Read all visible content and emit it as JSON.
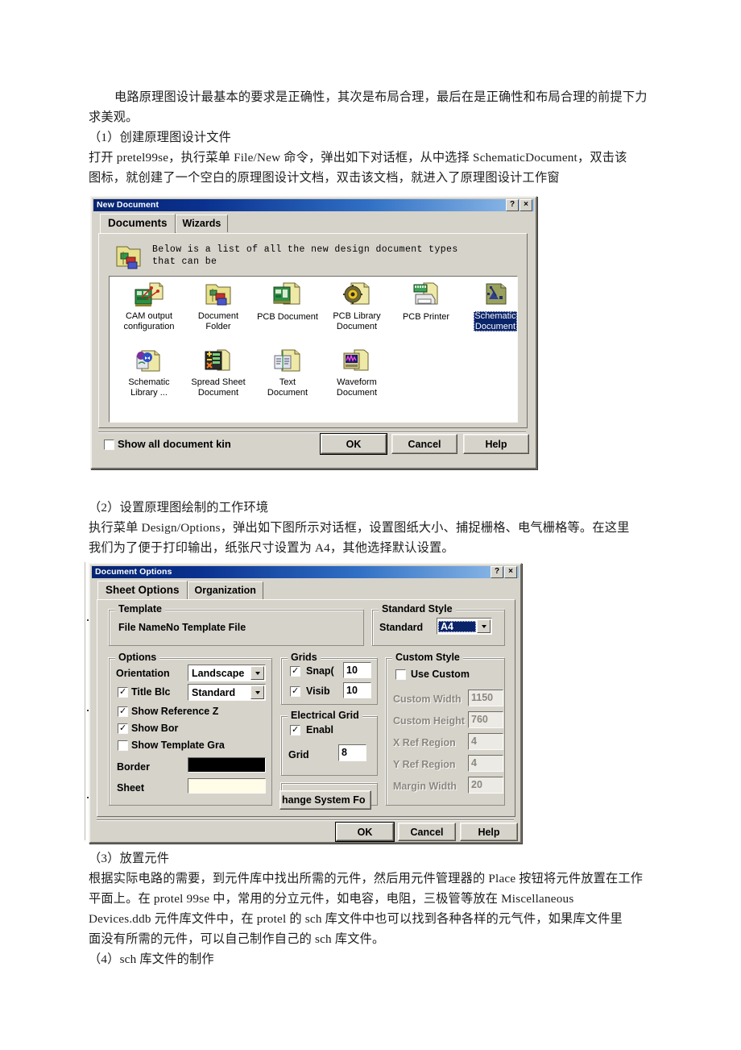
{
  "document": {
    "paragraphs": [
      "        电路原理图设计最基本的要求是正确性，其次是布局合理，最后在是正确性和布局合理的前提下力",
      "求美观。",
      "（1）创建原理图设计文件",
      "打开 pretel99se，执行菜单 File/New 命令，弹出如下对话框，从中选择 SchematicDocument，双击该",
      "图标，就创建了一个空白的原理图设计文档，双击该文档，就进入了原理图设计工作窗"
    ],
    "paragraphs_mid": [
      "（2）设置原理图绘制的工作环境",
      "执行菜单 Design/Options，弹出如下图所示对话框，设置图纸大小、捕捉栅格、电气栅格等。在这里",
      "我们为了便于打印输出，纸张尺寸设置为 A4，其他选择默认设置。"
    ],
    "paragraphs_end": [
      "（3）放置元件",
      "根据实际电路的需要，到元件库中找出所需的元件，然后用元件管理器的 Place 按钮将元件放置在工作",
      "平面上。在 protel 99se 中，常用的分立元件，如电容，电阻，三极管等放在 Miscellaneous",
      "Devices.ddb 元件库文件中，在 protel 的 sch 库文件中也可以找到各种各样的元气件，如果库文件里",
      "面没有所需的元件，可以自己制作自己的 sch 库文件。",
      "（4）sch 库文件的制作"
    ]
  },
  "new_document_dialog": {
    "title": "New Document",
    "help_button": "?",
    "close_button": "×",
    "tabs": [
      {
        "label": "Documents",
        "selected": true
      },
      {
        "label": "Wizards",
        "selected": false
      }
    ],
    "hint_line1": "Below is a list of all the new design document types",
    "hint_line2": "that can be",
    "items": [
      {
        "label": "CAM output\nconfiguration",
        "icon": "cam-output-icon",
        "selected": false
      },
      {
        "label": "Document\nFolder",
        "icon": "document-folder-icon",
        "selected": false
      },
      {
        "label": "PCB Document",
        "icon": "pcb-document-icon",
        "selected": false
      },
      {
        "label": "PCB Library\nDocument",
        "icon": "pcb-library-icon",
        "selected": false
      },
      {
        "label": "PCB Printer",
        "icon": "pcb-printer-icon",
        "selected": false
      },
      {
        "label": "Schematic\nDocument",
        "icon": "schematic-document-icon",
        "selected": true
      },
      {
        "label": "Schematic\nLibrary ...",
        "icon": "schematic-library-icon",
        "selected": false
      },
      {
        "label": "Spread Sheet\nDocument",
        "icon": "spread-sheet-icon",
        "selected": false
      },
      {
        "label": "Text\nDocument",
        "icon": "text-document-icon",
        "selected": false
      },
      {
        "label": "Waveform\nDocument",
        "icon": "waveform-document-icon",
        "selected": false
      }
    ],
    "show_all_checkbox": {
      "label": "Show all document kin",
      "checked": false
    },
    "buttons": {
      "ok": "OK",
      "cancel": "Cancel",
      "help": "Help"
    }
  },
  "document_options_dialog": {
    "title": "Document Options",
    "help_button": "?",
    "close_button": "×",
    "tabs": [
      {
        "label": "Sheet Options",
        "selected": true
      },
      {
        "label": "Organization",
        "selected": false
      }
    ],
    "template": {
      "caption": "Template",
      "file_name": "File NameNo Template File"
    },
    "standard_style": {
      "caption": "Standard Style",
      "label": "Standard",
      "value": "A4"
    },
    "options": {
      "caption": "Options",
      "orientation_label": "Orientation",
      "orientation_value": "Landscape",
      "title_block_label": "Title Blc",
      "title_block_checked": true,
      "title_block_value": "Standard",
      "show_reference_label": "Show Reference Z",
      "show_reference_checked": true,
      "show_border_label": "Show Bor",
      "show_border_checked": true,
      "show_template_label": "Show Template Gra",
      "show_template_checked": false,
      "border_label": "Border",
      "border_color": "#000000",
      "sheet_label": "Sheet",
      "sheet_color": "#fffce8"
    },
    "grids": {
      "caption": "Grids",
      "snap_label": "Snap(",
      "snap_checked": true,
      "snap_value": "10",
      "visible_label": "Visib",
      "visible_checked": true,
      "visible_value": "10"
    },
    "electrical_grid": {
      "caption": "Electrical Grid",
      "enable_label": "Enabl",
      "enable_checked": true,
      "grid_label": "Grid",
      "grid_value": "8"
    },
    "change_system_font_button": "hange System Fo",
    "custom_style": {
      "caption": "Custom Style",
      "use_custom_label": "Use Custom",
      "use_custom_checked": false,
      "fields": [
        {
          "label": "Custom Width",
          "value": "1150"
        },
        {
          "label": "Custom Height",
          "value": "760"
        },
        {
          "label": "X Ref Region",
          "value": "4"
        },
        {
          "label": "Y Ref Region",
          "value": "4"
        },
        {
          "label": "Margin Width",
          "value": "20"
        }
      ]
    },
    "buttons": {
      "ok": "OK",
      "cancel": "Cancel",
      "help": "Help"
    }
  }
}
